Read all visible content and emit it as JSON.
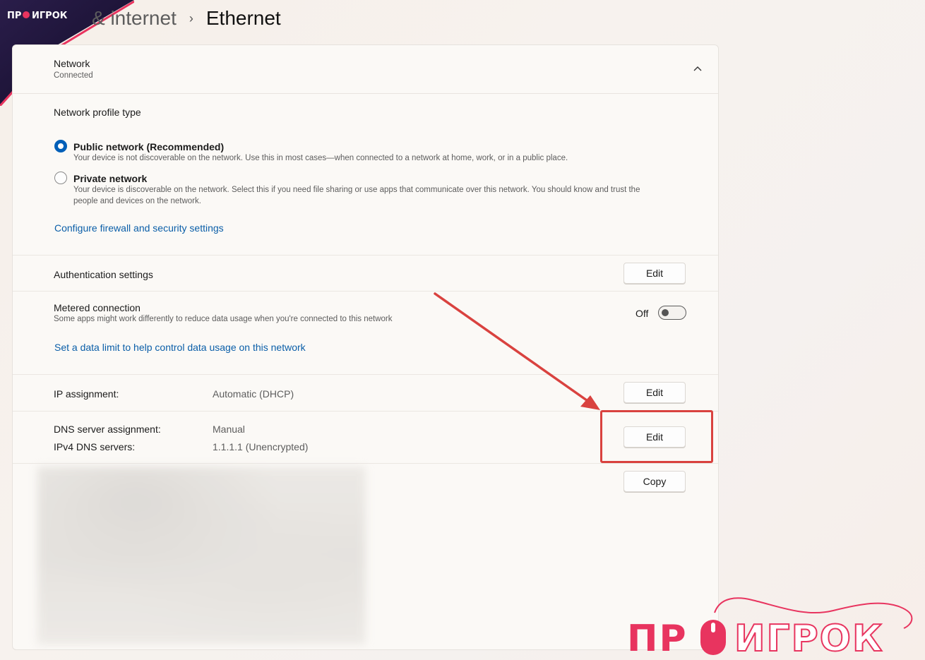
{
  "breadcrumb": {
    "previous": "& internet",
    "separator": "›",
    "current": "Ethernet"
  },
  "network": {
    "title": "Network",
    "status": "Connected"
  },
  "profile": {
    "heading": "Network profile type",
    "public": {
      "label": "Public network (Recommended)",
      "description": "Your device is not discoverable on the network. Use this in most cases—when connected to a network at home, work, or in a public place.",
      "selected": true
    },
    "private": {
      "label": "Private network",
      "description_line1": "Your device is discoverable on the network. Select this if you need file sharing or use apps that communicate over this network. You should know and trust the",
      "description_line2": "people and devices on the network.",
      "selected": false
    },
    "firewall_link": "Configure firewall and security settings"
  },
  "auth": {
    "label": "Authentication settings",
    "button": "Edit"
  },
  "metered": {
    "label": "Metered connection",
    "description": "Some apps might work differently to reduce data usage when you're connected to this network",
    "toggle_state": "Off",
    "toggle_on": false,
    "data_limit_link": "Set a data limit to help control data usage on this network"
  },
  "ip": {
    "label": "IP assignment:",
    "value": "Automatic (DHCP)",
    "button": "Edit"
  },
  "dns": {
    "label": "DNS server assignment:",
    "value": "Manual",
    "ipv4_label": "IPv4 DNS servers:",
    "ipv4_value": "1.1.1.1 (Unencrypted)",
    "button": "Edit"
  },
  "properties": {
    "copy_button": "Copy"
  },
  "watermark": {
    "text": "ПРОИГРОК"
  },
  "colors": {
    "accent": "#005fb8",
    "link": "#0a5ea8",
    "callout": "#d9423f",
    "logo_pink": "#e8345f"
  }
}
